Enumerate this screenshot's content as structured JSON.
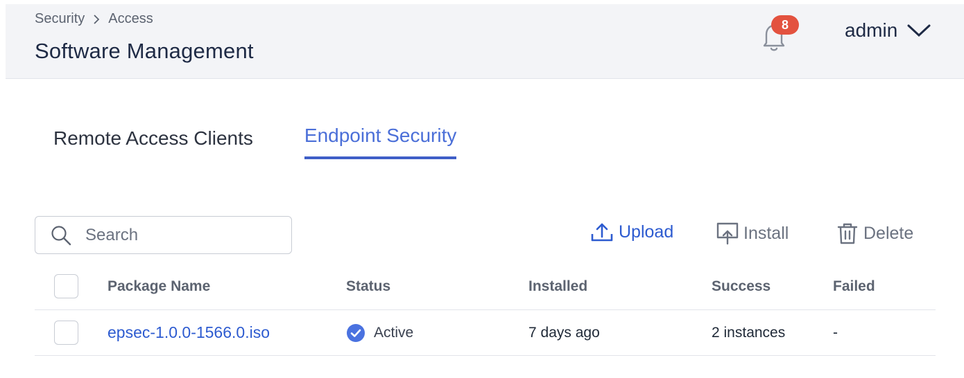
{
  "header": {
    "breadcrumb": [
      "Security",
      "Access"
    ],
    "title": "Software Management",
    "notifications": {
      "count": "8",
      "icon": "bell-icon"
    },
    "user": {
      "name": "admin",
      "icon": "chevron-down-icon"
    }
  },
  "tabs": [
    {
      "label": "Remote Access Clients",
      "active": false
    },
    {
      "label": "Endpoint Security",
      "active": true
    }
  ],
  "search": {
    "placeholder": "Search",
    "value": ""
  },
  "toolbar": {
    "upload_label": "Upload",
    "install_label": "Install",
    "delete_label": "Delete"
  },
  "table": {
    "columns": [
      "Package Name",
      "Status",
      "Installed",
      "Success",
      "Failed"
    ],
    "rows": [
      {
        "package_name": "epsec-1.0.0-1566.0.iso",
        "status": "Active",
        "installed": "7 days ago",
        "success": "2 instances",
        "failed": "-"
      }
    ]
  },
  "colors": {
    "accent": "#3f5fc7",
    "link": "#2d5bd0",
    "badge": "#e3523f",
    "status_active": "#4a72e0",
    "header_bg": "#f3f4f7"
  }
}
